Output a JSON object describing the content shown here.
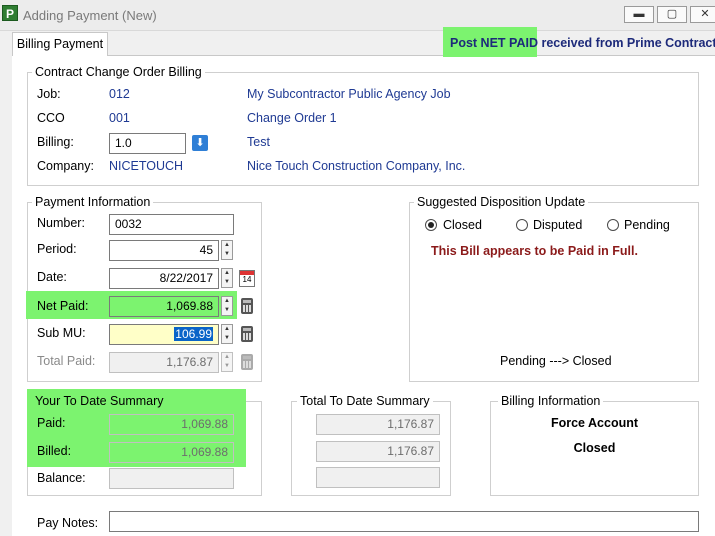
{
  "window": {
    "icon_letter": "P",
    "title": "Adding Payment  (New)",
    "min": "▬",
    "max": "▢",
    "close": "✕"
  },
  "tab": {
    "label": "Billing Payment"
  },
  "banner": {
    "bold": "Post NET PAID",
    "rest": " received from Prime Contractor"
  },
  "cco": {
    "title": "Contract Change Order Billing",
    "job_label": "Job:",
    "job_code": "012",
    "job_name": "My Subcontractor Public Agency Job",
    "cco_label": "CCO",
    "cco_code": "001",
    "cco_name": "Change Order 1",
    "billing_label": "Billing:",
    "billing_value": "1.0",
    "billing_name": "Test",
    "company_label": "Company:",
    "company_code": "NICETOUCH",
    "company_name": "Nice Touch Construction Company, Inc."
  },
  "payment": {
    "title": "Payment Information",
    "number_label": "Number:",
    "number_value": "0032",
    "period_label": "Period:",
    "period_value": "45",
    "date_label": "Date:",
    "date_value": "8/22/2017",
    "calendar_day": "14",
    "netpaid_label": "Net Paid:",
    "netpaid_value": "1,069.88",
    "submu_label": "Sub MU:",
    "submu_value": "106.99",
    "total_label": "Total Paid:",
    "total_value": "1,176.87"
  },
  "disposition": {
    "title": "Suggested Disposition Update",
    "options": [
      "Closed",
      "Disputed",
      "Pending"
    ],
    "selected": "Closed",
    "message": "This Bill appears to be Paid in Full.",
    "transition": "Pending ---> Closed"
  },
  "ytd": {
    "title": "Your To Date Summary",
    "paid_label": "Paid:",
    "paid_value": "1,069.88",
    "billed_label": "Billed:",
    "billed_value": "1,069.88",
    "balance_label": "Balance:",
    "balance_value": ""
  },
  "ttd": {
    "title": "Total To Date Summary",
    "v1": "1,176.87",
    "v2": "1,176.87",
    "v3": ""
  },
  "billing_info": {
    "title": "Billing Information",
    "line1": "Force Account",
    "line2": "Closed"
  },
  "notes": {
    "label": "Pay Notes:",
    "value": ""
  },
  "colors": {
    "highlight": "#7cf36f",
    "link_blue": "#1f3a93",
    "message_red": "#8b1a1a",
    "submu_bg": "#ffffc8",
    "selection": "#0a64c8"
  }
}
